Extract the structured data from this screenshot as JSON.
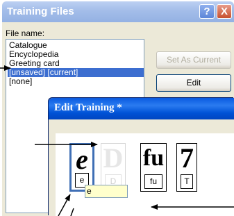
{
  "training_files": {
    "title": "Training Files",
    "help_symbol": "?",
    "close_symbol": "X",
    "file_name_label": "File name:",
    "files": [
      "Catalogue",
      "Encyclopedia",
      "Greeting card",
      "[unsaved] [current]",
      "[none]"
    ],
    "selected_index": 3,
    "set_as_current_label": "Set As Current",
    "edit_label": "Edit"
  },
  "edit_training": {
    "title": "Edit Training *",
    "glyphs": [
      {
        "image": "e",
        "label": "e",
        "state": "selected"
      },
      {
        "image": "D",
        "label": "D",
        "state": "faded"
      },
      {
        "image": "fu",
        "label": "fu",
        "state": "normal"
      },
      {
        "image": "7",
        "label": "T",
        "state": "normal"
      }
    ],
    "label_input_value": "e"
  },
  "colors": {
    "selection_blue": "#3c6ed0",
    "active_title": "#0a5ae0",
    "inactive_title": "#a3bde9",
    "input_highlight": "#ffffcc"
  }
}
